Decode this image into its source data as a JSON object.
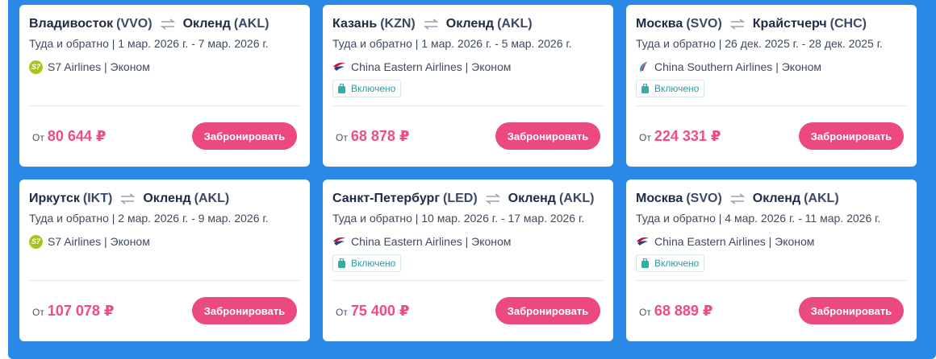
{
  "cards": [
    {
      "from_city": "Владивосток",
      "from_code": "(VVO)",
      "to_city": "Окленд",
      "to_code": "(AKL)",
      "dates": "Туда и обратно | 1 мар. 2026 г. - 7 мар. 2026 г.",
      "airline_logo": "s7-logo",
      "airline_logo_text": "S7",
      "airline": "S7 Airlines | Эконом",
      "baggage": null,
      "price_prefix": "От",
      "price": "80 644 ₽",
      "button": "Забронировать"
    },
    {
      "from_city": "Казань",
      "from_code": "(KZN)",
      "to_city": "Окленд",
      "to_code": "(AKL)",
      "dates": "Туда и обратно | 1 мар. 2026 г. - 5 мар. 2026 г.",
      "airline_logo": "china-eastern-logo",
      "airline": "China Eastern Airlines | Эконом",
      "baggage": "Включено",
      "price_prefix": "От",
      "price": "68 878 ₽",
      "button": "Забронировать"
    },
    {
      "from_city": "Москва",
      "from_code": "(SVO)",
      "to_city": "Крайстчерч",
      "to_code": "(CHC)",
      "dates": "Туда и обратно | 26 дек. 2025 г. - 28 дек. 2025 г.",
      "airline_logo": "china-southern-logo",
      "airline": "China Southern Airlines | Эконом",
      "baggage": "Включено",
      "price_prefix": "От",
      "price": "224 331 ₽",
      "button": "Забронировать"
    },
    {
      "from_city": "Иркутск",
      "from_code": "(IKT)",
      "to_city": "Окленд",
      "to_code": "(AKL)",
      "dates": "Туда и обратно | 2 мар. 2026 г. - 9 мар. 2026 г.",
      "airline_logo": "s7-logo",
      "airline_logo_text": "S7",
      "airline": "S7 Airlines | Эконом",
      "baggage": null,
      "price_prefix": "От",
      "price": "107 078 ₽",
      "button": "Забронировать"
    },
    {
      "from_city": "Санкт-Петербург",
      "from_code": "(LED)",
      "to_city": "Окленд",
      "to_code": "(AKL)",
      "dates": "Туда и обратно | 10 мар. 2026 г. - 17 мар. 2026 г.",
      "airline_logo": "china-eastern-logo",
      "airline": "China Eastern Airlines | Эконом",
      "baggage": "Включено",
      "price_prefix": "От",
      "price": "75 400 ₽",
      "button": "Забронировать"
    },
    {
      "from_city": "Москва",
      "from_code": "(SVO)",
      "to_city": "Окленд",
      "to_code": "(AKL)",
      "dates": "Туда и обратно | 4 мар. 2026 г. - 11 мар. 2026 г.",
      "airline_logo": "china-eastern-logo",
      "airline": "China Eastern Airlines | Эконом",
      "baggage": "Включено",
      "price_prefix": "От",
      "price": "68 889 ₽",
      "button": "Забронировать"
    }
  ],
  "colors": {
    "panel_bg": "#2a88e6",
    "price": "#ef4d7f",
    "button": "#ec4a7e",
    "baggage_text": "#2f9aa0"
  }
}
